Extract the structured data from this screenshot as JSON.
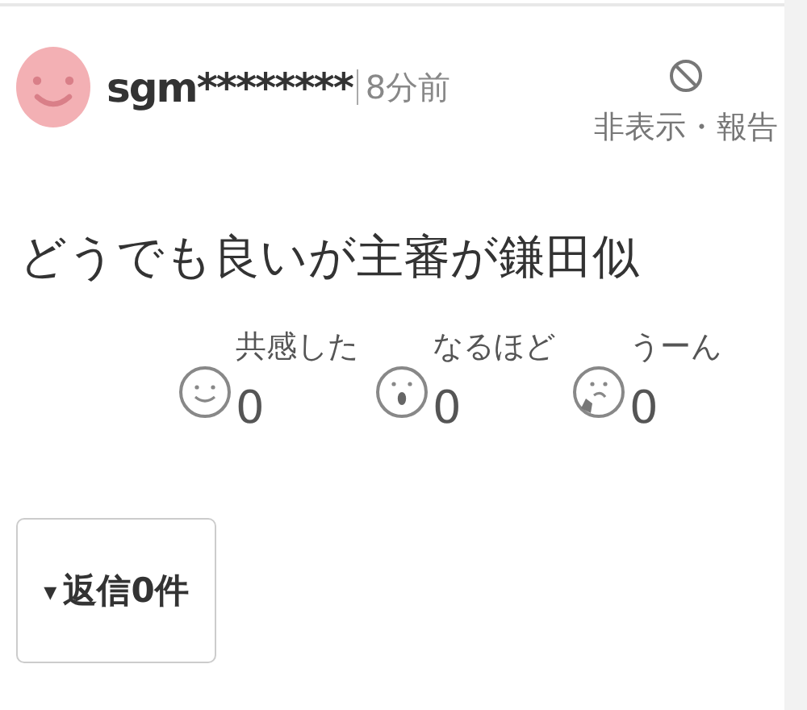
{
  "comment": {
    "username": "sgm********",
    "time": "8分前",
    "hide_report": "非表示・報告",
    "text": "どうでも良いが主審が鎌田似"
  },
  "reactions": [
    {
      "kind": "smile",
      "label": "共感した",
      "count": "0"
    },
    {
      "kind": "surprised",
      "label": "なるほど",
      "count": "0"
    },
    {
      "kind": "thinking",
      "label": "うーん",
      "count": "0"
    }
  ],
  "reply_button": {
    "arrow": "▾",
    "label": "返信0件"
  }
}
